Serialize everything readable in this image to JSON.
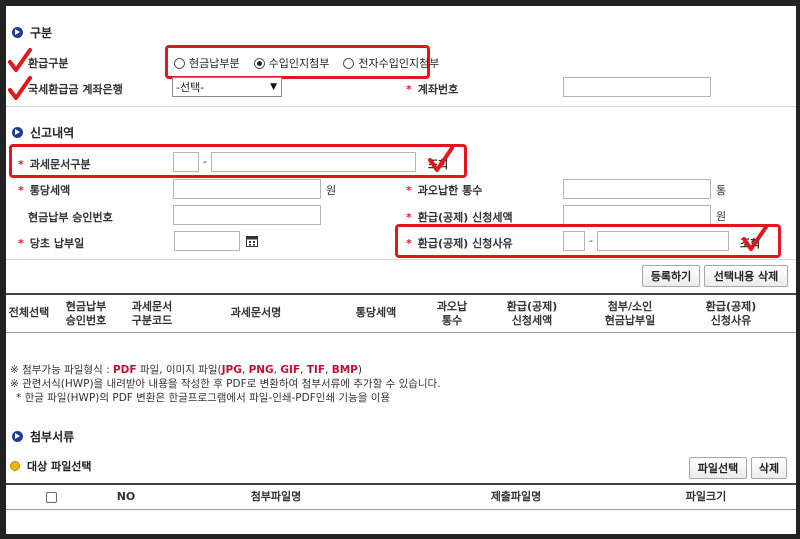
{
  "sections": {
    "division": "구분",
    "report": "신고내역",
    "attachments": "첨부서류"
  },
  "refund_type": {
    "label": "환급구분",
    "options": [
      "현금납부분",
      "수입인지첨부",
      "전자수입인지첨부"
    ],
    "selected": 1
  },
  "bank": {
    "label": "국세환급금 계좌은행",
    "select_value": "-선택-",
    "account_label": "계좌번호"
  },
  "report": {
    "tax_doc_label": "과세문서구분",
    "dash": "-",
    "lookup": "조회",
    "amount_label": "통당세액",
    "won": "원",
    "overpaid_label": "과오납한 통수",
    "count_unit": "통",
    "cash_approval_label": "현금납부 승인번호",
    "refund_amount_label": "환급(공제) 신청세액",
    "original_date_label": "당초 납부일",
    "refund_reason_label": "환급(공제) 신청사유",
    "calendar_icon": "calendar-icon"
  },
  "buttons": {
    "register": "등록하기",
    "delete_selected": "선택내용 삭제",
    "select_file": "파일선택",
    "delete": "삭제"
  },
  "table": {
    "headers": [
      [
        "전체선택"
      ],
      [
        "현금납부",
        "승인번호"
      ],
      [
        "과세문서",
        "구분코드"
      ],
      [
        "과세문서명"
      ],
      [
        "통당세액"
      ],
      [
        "과오납",
        "통수"
      ],
      [
        "환급(공제)",
        "신청세액"
      ],
      [
        "첨부/소인",
        "현금납부일"
      ],
      [
        "환급(공제)",
        "신청사유"
      ]
    ]
  },
  "notes": {
    "n1_pre": "※ 첨부가능 파일형식 : ",
    "n1_pdf": "PDF",
    "n1_mid": " 파일, 이미지 파일(",
    "n1_jpg": "JPG",
    "n1_png": "PNG",
    "n1_gif": "GIF",
    "n1_tif": "TIF",
    "n1_bmp": "BMP",
    "n1_sep": ", ",
    "n1_end": ")",
    "n2": "※ 관련서식(HWP)을 내려받아 내용을 작성한 후 PDF로 변환하여 첨부서류에 추가할 수 있습니다.",
    "n3": "* 한글 파일(HWP)의 PDF 변환은 한글프로그램에서 파일-인쇄-PDF인쇄 기능을 이용"
  },
  "attachments": {
    "target_label": "대상 파일선택",
    "headers": [
      "NO",
      "첨부파일명",
      "제출파일명",
      "파일크기"
    ]
  },
  "colors": {
    "accent": "#1e3a9a",
    "required": "#d4202a",
    "highlight": "#e0181e"
  }
}
